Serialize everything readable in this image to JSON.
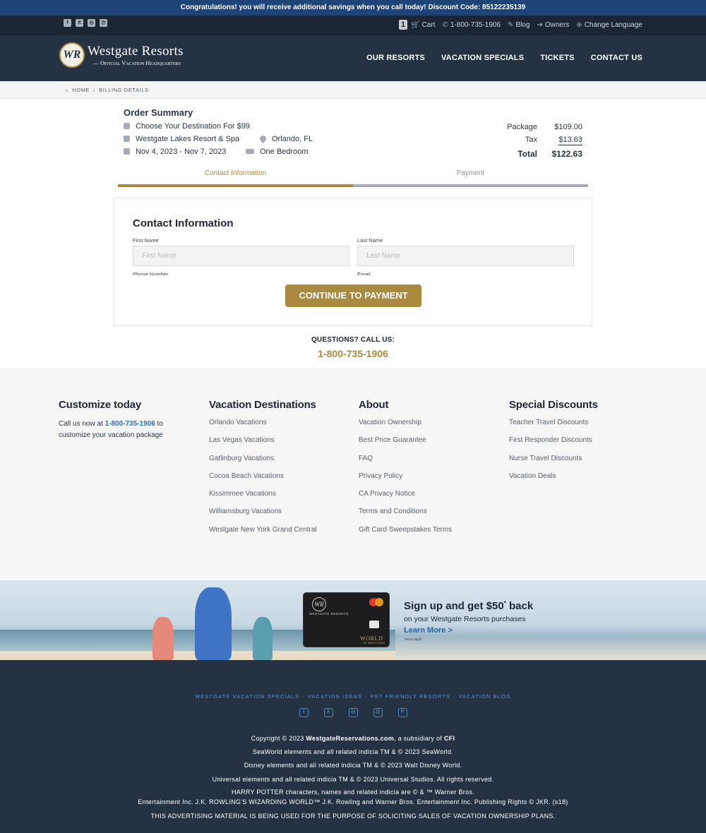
{
  "promo": {
    "text": "Congratulations! you will receive additional savings when you call today! Discount Code: 85122235139"
  },
  "utility": {
    "cart_count": "1",
    "cart_label": "Cart",
    "phone": "1-800-735-1906",
    "blog": "Blog",
    "owners": "Owners",
    "language": "Change Language"
  },
  "header": {
    "logo_mark": "WR",
    "logo_name": "Westgate Resorts",
    "logo_tagline": "— Official Vacation Headquarters",
    "nav": [
      "OUR RESORTS",
      "VACATION SPECIALS",
      "TICKETS",
      "CONTACT US"
    ]
  },
  "breadcrumb": {
    "home": "HOME",
    "separator": "›",
    "current": "BILLING DETAILS"
  },
  "order": {
    "title": "Order Summary",
    "package_name": "Choose Your Destination For $99",
    "resort": "Westgate Lakes Resort & Spa",
    "location": "Orlando, FL",
    "dates": "Nov 4, 2023 - Nov 7, 2023",
    "room": "One Bedroom",
    "package_label": "Package",
    "package_price": "$109.00",
    "tax_label": "Tax",
    "tax_price": "$13.63",
    "total_label": "Total",
    "total_price": "$122.63"
  },
  "steps": {
    "step1": "Contact Information",
    "step2": "Payment",
    "progress_fraction": 0.5
  },
  "form": {
    "heading": "Contact Information",
    "first_name_label": "First Name",
    "first_name_placeholder": "First Name",
    "last_name_label": "Last Name",
    "last_name_placeholder": "Last Name",
    "phone_label": "Phone Number",
    "email_label": "Email",
    "submit": "CONTINUE TO PAYMENT"
  },
  "questions": {
    "label": "QUESTIONS? CALL US:",
    "phone": "1-800-735-1906"
  },
  "footer": {
    "customize": {
      "title": "Customize today",
      "text_before": "Call us now at ",
      "phone": "1-800-735-1906",
      "text_after": " to customize your vacation package"
    },
    "destinations": {
      "title": "Vacation Destinations",
      "links": [
        "Orlando Vacations",
        "Las Vegas Vacations",
        "Gatlinburg Vacations",
        "Cocoa Beach Vacations",
        "Kissimmee Vacations",
        "Williamsburg Vacations",
        "Westgate New York Grand Central"
      ]
    },
    "about": {
      "title": "About",
      "links": [
        "Vacation Ownership",
        "Best Price Guarantee",
        "FAQ",
        "Privacy Policy",
        "CA Privacy Notice",
        "Terms and Conditions",
        "Gift Card Sweepstakes Terms"
      ]
    },
    "discounts": {
      "title": "Special Discounts",
      "links": [
        "Teacher Travel Discounts",
        "First Responder Discounts",
        "Nurse Travel Discounts",
        "Vacation Deals"
      ]
    }
  },
  "banner": {
    "headline_pre": "Sign up and get $50",
    "headline_sup": "*",
    "headline_post": " back",
    "subline": "on your Westgate Resorts purchases",
    "link": "Learn More >",
    "fine": "*terms apply",
    "card_mark": "WR",
    "card_brand": "WESTGATE RESORTS",
    "card_world": "WORLD",
    "card_sub": "OF WESTGATE"
  },
  "bottom": {
    "links": [
      "WESTGATE VACATION SPECIALS",
      "VACATION IDEAS",
      "PET FRIENDLY RESORTS",
      "VACATION BLOG"
    ],
    "link_separator": "·",
    "copyright_pre": "Copyright © 2023 ",
    "copyright_site": "WestgateReservations.com",
    "copyright_mid": ", a subsidiary of ",
    "copyright_cfi": "CFI",
    "seaworld": "SeaWorld elements and all related indicia TM & © 2023 SeaWorld.",
    "disney": "Disney elements and all related indicia TM & © 2023 Walt Disney World.",
    "universal": "Universal elements and all related indicia TM & © 2023 Universal Studios. All rights reserved.",
    "hp1": "HARRY POTTER characters, names and related indicia are © & ™ Warner Bros.",
    "hp2": "Entertainment Inc. J.K. ROWLING'S WIZARDING WORLD™ J.K. Rowling and Warner Bros. Entertainment Inc. Publishing Rights © JKR. (s18)",
    "disclaimer": "THIS ADVERTISING MATERIAL IS BEING USED FOR THE PURPOSE OF SOLICITING SALES OF VACATION OWNERSHIP PLANS."
  },
  "colors": {
    "gold": "#a98a3f",
    "navy": "#253244",
    "promo_blue": "#1f4477",
    "link_blue": "#2f6fb6"
  }
}
